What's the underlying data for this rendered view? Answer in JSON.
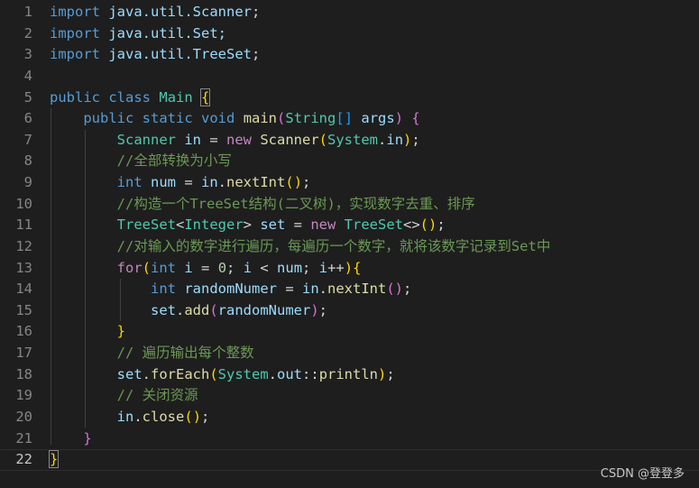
{
  "editor": {
    "language": "java",
    "current_line": 22,
    "lines": [
      {
        "number": "1",
        "text": "import java.util.Scanner;"
      },
      {
        "number": "2",
        "text": "import java.util.Set;"
      },
      {
        "number": "3",
        "text": "import java.util.TreeSet;"
      },
      {
        "number": "4",
        "text": ""
      },
      {
        "number": "5",
        "text": "public class Main {"
      },
      {
        "number": "6",
        "text": "    public static void main(String[] args) {"
      },
      {
        "number": "7",
        "text": "        Scanner in = new Scanner(System.in);"
      },
      {
        "number": "8",
        "text": "        //全部转换为小写"
      },
      {
        "number": "9",
        "text": "        int num = in.nextInt();"
      },
      {
        "number": "10",
        "text": "        //构造一个TreeSet结构(二叉树)，实现数字去重、排序"
      },
      {
        "number": "11",
        "text": "        TreeSet<Integer> set = new TreeSet<>();"
      },
      {
        "number": "12",
        "text": "        //对输入的数字进行遍历，每遍历一个数字，就将该数字记录到Set中"
      },
      {
        "number": "13",
        "text": "        for(int i = 0; i < num; i++){"
      },
      {
        "number": "14",
        "text": "            int randomNumer = in.nextInt();"
      },
      {
        "number": "15",
        "text": "            set.add(randomNumer);"
      },
      {
        "number": "16",
        "text": "        }"
      },
      {
        "number": "17",
        "text": "        // 遍历输出每个整数"
      },
      {
        "number": "18",
        "text": "        set.forEach(System.out::println);"
      },
      {
        "number": "19",
        "text": "        // 关闭资源"
      },
      {
        "number": "20",
        "text": "        in.close();"
      },
      {
        "number": "21",
        "text": "    }"
      },
      {
        "number": "22",
        "text": "}"
      }
    ]
  },
  "colors": {
    "background": "#1e1e1e",
    "keyword": "#569cd6",
    "control": "#c586c0",
    "type": "#4ec9b0",
    "function": "#dcdcaa",
    "variable": "#9cdcfe",
    "number": "#b5cea8",
    "comment": "#6a9955",
    "bracket_level_1": "#ffd700",
    "bracket_level_2": "#da70d6",
    "bracket_level_3": "#179fff"
  },
  "watermark": "CSDN @登登多"
}
